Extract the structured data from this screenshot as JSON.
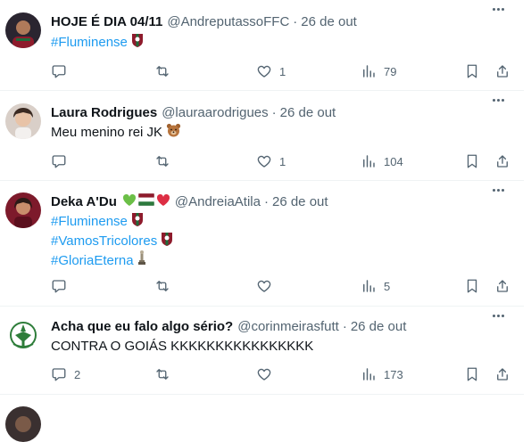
{
  "tweets": [
    {
      "name": "HOJE É DIA 04/11",
      "handle": "@AndreputassoFFC",
      "separator": "·",
      "time": "26 de out",
      "lines": [
        "#Fluminense"
      ],
      "replies": "",
      "retweets": "",
      "likes": "1",
      "views": "79"
    },
    {
      "name": "Laura Rodrigues",
      "handle": "@lauraarodrigues",
      "separator": "·",
      "time": "26 de out",
      "lines": [
        "Meu menino rei JK"
      ],
      "replies": "",
      "retweets": "",
      "likes": "1",
      "views": "104"
    },
    {
      "name": "Deka A'Du",
      "handle": "@AndreiaAtila",
      "separator": "·",
      "time": "26 de out",
      "lines": [
        "#Fluminense",
        "#VamosTricolores",
        "#GloriaEterna"
      ],
      "replies": "",
      "retweets": "",
      "likes": "",
      "views": "5"
    },
    {
      "name": "Acha que eu falo algo sério?",
      "handle": "@corinmeirasfutt",
      "separator": "·",
      "time": "26 de out",
      "lines": [
        "CONTRA O GOIÁS KKKKKKKKKKKKKKKK"
      ],
      "replies": "2",
      "retweets": "",
      "likes": "",
      "views": "173"
    }
  ],
  "colors": {
    "text": "#0f1419",
    "secondary": "#536471",
    "link": "#1d9bf0",
    "divider": "#eff3f4"
  },
  "icons": {
    "reply": "speech-bubble-icon",
    "retweet": "retweet-arrows-icon",
    "like": "heart-icon",
    "views": "bar-chart-icon",
    "bookmark": "bookmark-icon",
    "share": "share-upload-icon",
    "more": "more-dots-icon"
  }
}
